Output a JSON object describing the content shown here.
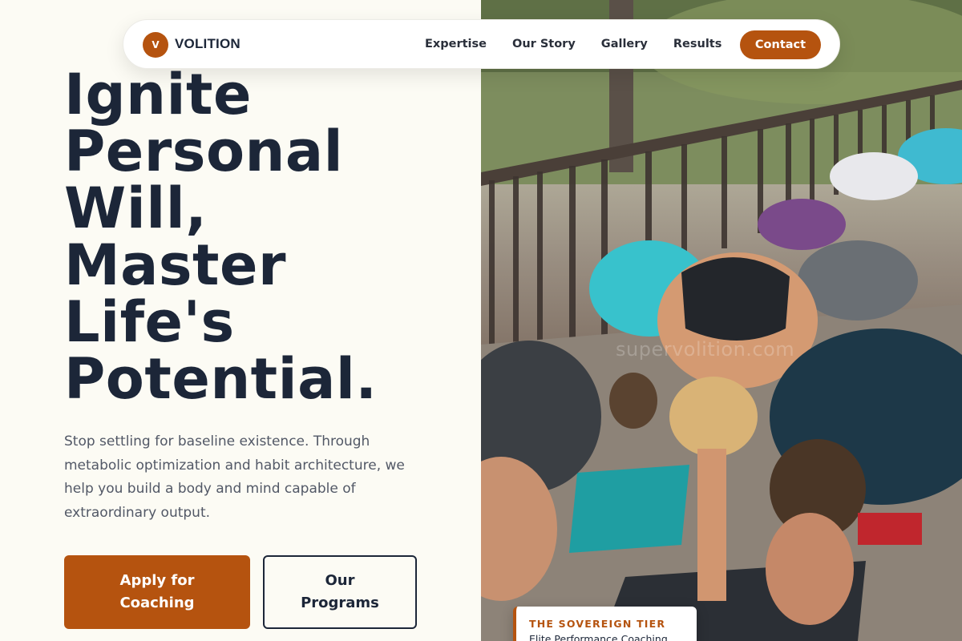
{
  "brand": {
    "badge": "V",
    "name": "VOLITION"
  },
  "nav": {
    "links": [
      "Expertise",
      "Our Story",
      "Gallery",
      "Results"
    ],
    "contact": "Contact"
  },
  "hero": {
    "headline_lines": [
      "Ignite",
      "Personal",
      "Will,",
      "Master",
      "Life's",
      "Potential."
    ],
    "subtext": "Stop settling for baseline existence. Through metabolic optimization and habit architecture, we help you build a body and mind capable of extraordinary output.",
    "primary_cta": "Apply for Coaching",
    "secondary_cta": "Our Programs"
  },
  "image": {
    "watermark": "supervolition.com",
    "tier_card": {
      "title": "THE SOVEREIGN TIER",
      "subtitle": "Elite Performance Coaching"
    }
  },
  "colors": {
    "accent": "#b5530f",
    "ink": "#1c2638",
    "background": "#fcfbf4"
  }
}
